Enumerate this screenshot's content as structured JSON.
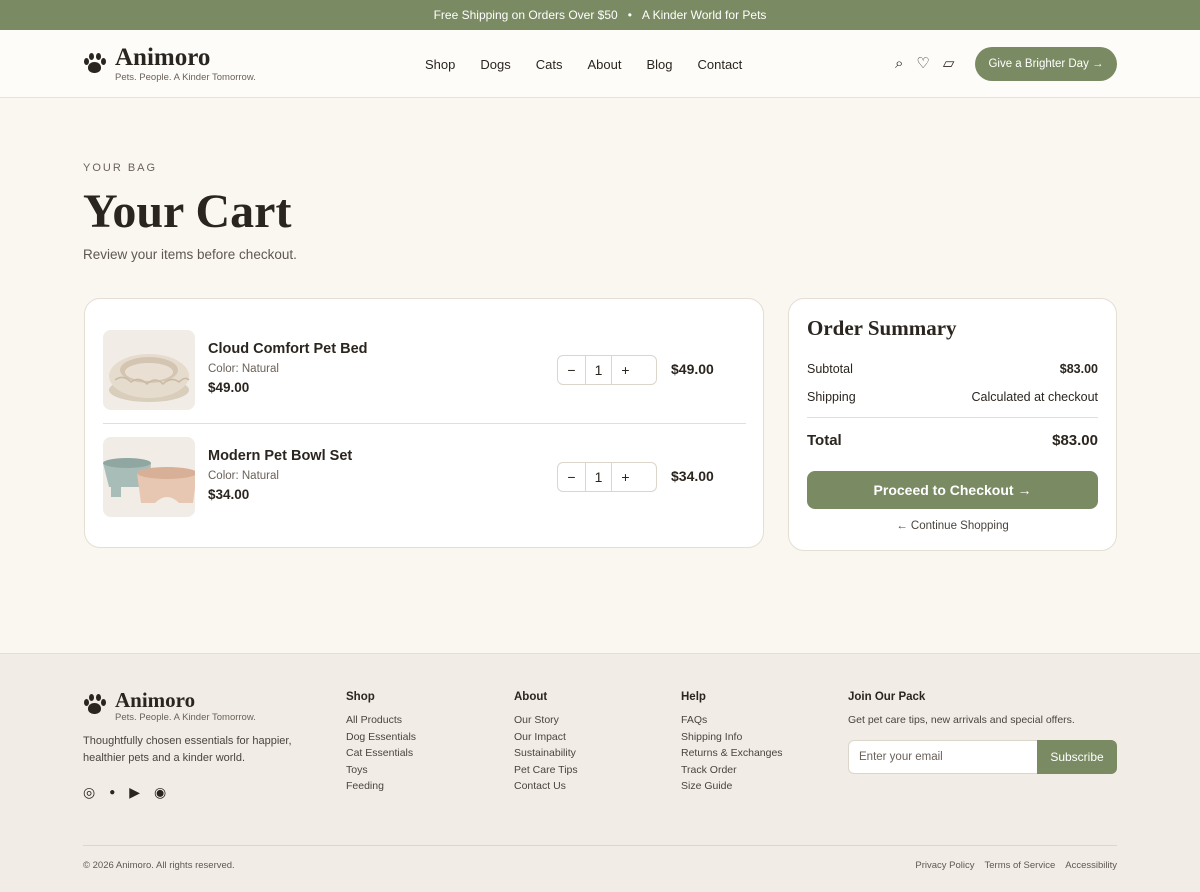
{
  "announcement": {
    "left": "Free Shipping on Orders Over $50",
    "separator": "•",
    "right": "A Kinder World for Pets"
  },
  "brand": {
    "name": "Animoro",
    "tagline": "Pets. People. A Kinder Tomorrow."
  },
  "nav": {
    "items": [
      "Shop",
      "Dogs",
      "Cats",
      "About",
      "Blog",
      "Contact"
    ]
  },
  "header_icons": {
    "search": "⌕",
    "wishlist": "♡",
    "bag": "▱"
  },
  "header_cta": "Give a Brighter Day →",
  "hero": {
    "eyebrow": "YOUR BAG",
    "title": "Your Cart",
    "subtitle": "Review your items before checkout."
  },
  "cart": {
    "items": [
      {
        "name": "Cloud Comfort Pet Bed",
        "color": "Color: Natural",
        "unit_price": "$49.00",
        "quantity": "1",
        "line_total": "$49.00",
        "minus": "−",
        "plus": "+"
      },
      {
        "name": "Modern Pet Bowl Set",
        "color": "Color: Natural",
        "unit_price": "$34.00",
        "quantity": "1",
        "line_total": "$34.00",
        "minus": "−",
        "plus": "+"
      }
    ]
  },
  "summary": {
    "title": "Order Summary",
    "subtotal_label": "Subtotal",
    "subtotal_value": "$83.00",
    "shipping_label": "Shipping",
    "shipping_value": "Calculated at checkout",
    "total_label": "Total",
    "total_value": "$83.00",
    "checkout_label": "Proceed to Checkout →",
    "continue_label": "← Continue Shopping"
  },
  "footer": {
    "description": "Thoughtfully chosen essentials for happier, healthier pets and a kinder world.",
    "socials": [
      "◎",
      "●",
      "▶",
      "◉"
    ],
    "shop": {
      "heading": "Shop",
      "links": [
        "All Products",
        "Dog Essentials",
        "Cat Essentials",
        "Toys",
        "Feeding"
      ]
    },
    "about": {
      "heading": "About",
      "links": [
        "Our Story",
        "Our Impact",
        "Sustainability",
        "Pet Care Tips",
        "Contact Us"
      ]
    },
    "help": {
      "heading": "Help",
      "links": [
        "FAQs",
        "Shipping Info",
        "Returns & Exchanges",
        "Track Order",
        "Size Guide"
      ]
    },
    "join": {
      "heading": "Join Our Pack",
      "text": "Get pet care tips, new arrivals and special offers.",
      "email_placeholder": "Enter your email",
      "subscribe_label": "Subscribe"
    },
    "copyright": "© 2026 Animoro. All rights reserved.",
    "legal": [
      "Privacy Policy",
      "Terms of Service",
      "Accessibility"
    ]
  },
  "colors": {
    "accent": "#7a8a62",
    "background": "#faf7f1",
    "footer_bg": "#f1ede6",
    "text": "#2b2520"
  }
}
